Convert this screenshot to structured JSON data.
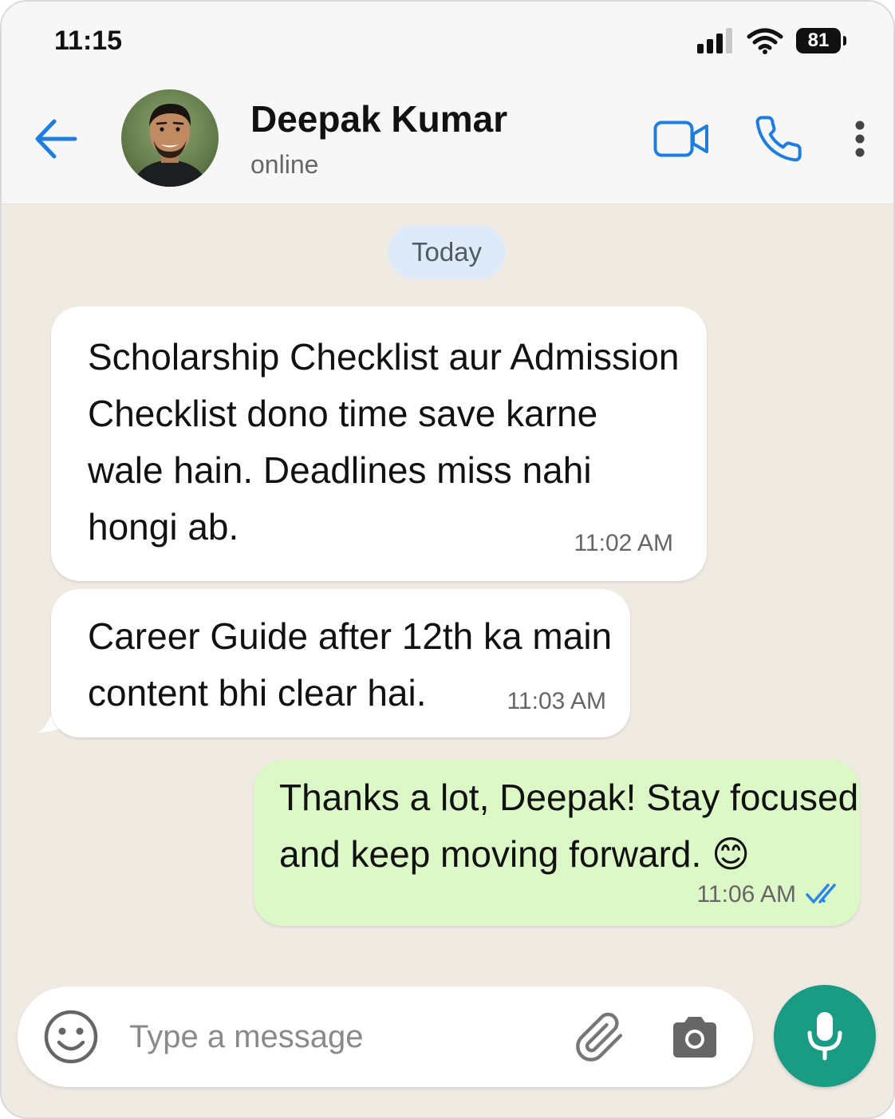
{
  "status_bar": {
    "time": "11:15",
    "battery": "81"
  },
  "header": {
    "contact_name": "Deepak Kumar",
    "contact_status": "online"
  },
  "chat": {
    "date_chip": "Today",
    "messages": [
      {
        "direction": "incoming",
        "lines": [
          "Scholarship Checklist aur Admission",
          "Checklist dono time save karne",
          "wale hain. Deadlines miss nahi",
          "hongi ab."
        ],
        "time": "11:02 AM"
      },
      {
        "direction": "incoming",
        "lines": [
          "Career Guide after 12th ka main",
          "content bhi clear hai."
        ],
        "time": "11:03 AM"
      },
      {
        "direction": "outgoing",
        "lines": [
          "Thanks a lot, Deepak! Stay focused",
          "and keep moving forward. 😊"
        ],
        "time": "11:06 AM",
        "receipt": "read"
      }
    ]
  },
  "composer": {
    "placeholder": "Type a message",
    "value": ""
  },
  "colors": {
    "accent_blue": "#1e7ee0",
    "outgoing_bubble": "#dcf8c6",
    "incoming_bubble": "#ffffff",
    "chat_background": "#efeae2",
    "mic_button": "#1a9b84",
    "read_ticks": "#2e86e6"
  },
  "icons": {
    "back": "arrow-left-icon",
    "video": "video-camera-icon",
    "call": "phone-icon",
    "menu": "more-vertical-icon",
    "emoji": "smiley-icon",
    "attach": "paperclip-icon",
    "camera": "camera-icon",
    "mic": "microphone-icon",
    "signal": "cellular-signal-icon",
    "wifi": "wifi-icon",
    "battery": "battery-icon",
    "ticks": "double-check-icon"
  }
}
